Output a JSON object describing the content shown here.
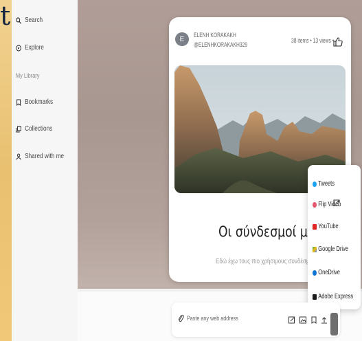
{
  "brand_letter": "t",
  "sidebar": {
    "search": "Search",
    "explore": "Explore",
    "library_heading": "My Library",
    "bookmarks": "Bookmarks",
    "collections": "Collections",
    "shared": "Shared with me"
  },
  "card": {
    "avatar_initial": "E",
    "author_name": "ELENH KORAKAKH",
    "author_handle": "@ELENHKORAKAKH329",
    "stats": "38 items • 13 views •",
    "title": "Οι σύνδεσμοί μου",
    "description": "Εδώ έχω τους πιο χρήσιμους συνδέσμους"
  },
  "share_menu": {
    "items": [
      "Tweets",
      "Flip Video",
      "YouTube",
      "Google Drive",
      "OneDrive",
      "Adobe Express"
    ]
  },
  "input_bar": {
    "placeholder": "Paste any web address"
  },
  "icons": [
    "search-icon",
    "explore-icon",
    "bookmark-icon",
    "collections-icon",
    "shared-icon",
    "thumbs-up-icon",
    "link-icon",
    "external-link-icon"
  ]
}
